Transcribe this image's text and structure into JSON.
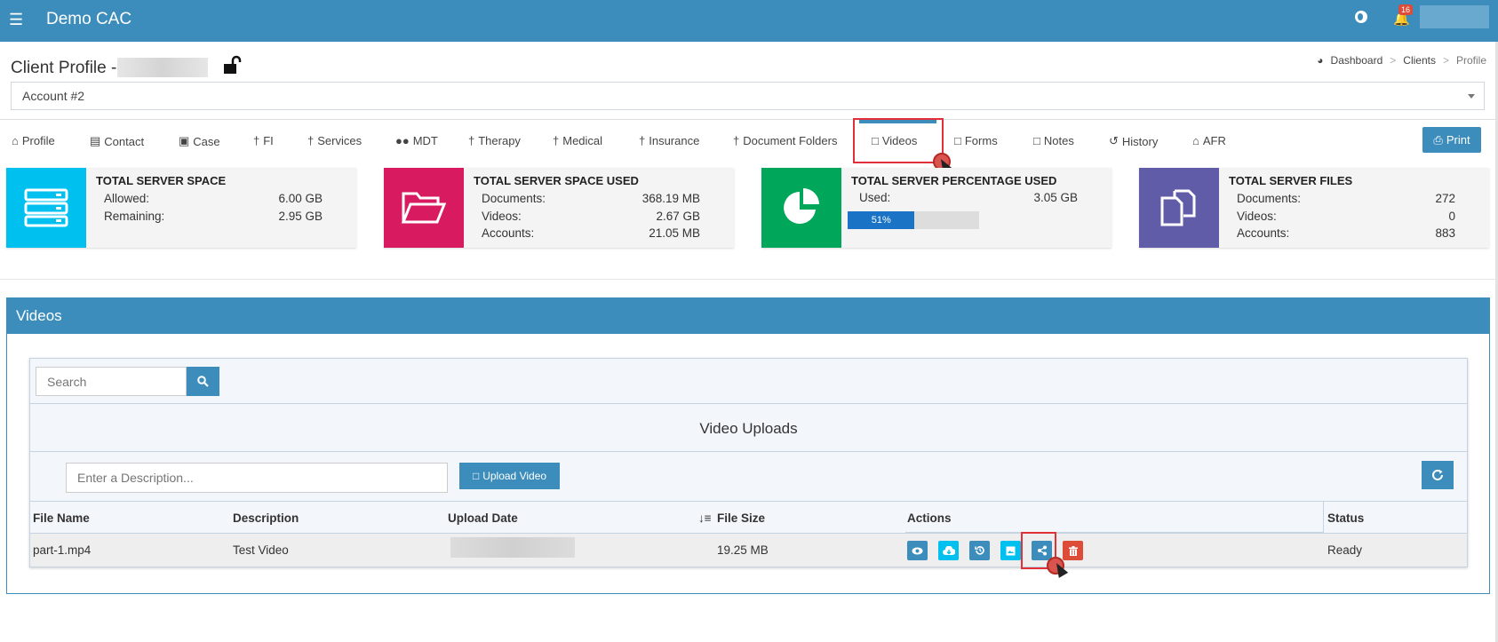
{
  "header": {
    "app_title": "Demo CAC",
    "notification_count": "16"
  },
  "page": {
    "title": "Client Profile -",
    "account_select": "Account #2"
  },
  "breadcrumb": [
    "Dashboard",
    "Clients",
    "Profile"
  ],
  "tabs": [
    {
      "label": "Profile"
    },
    {
      "label": "Contact"
    },
    {
      "label": "Case"
    },
    {
      "label": "FI"
    },
    {
      "label": "Services"
    },
    {
      "label": "MDT"
    },
    {
      "label": "Therapy"
    },
    {
      "label": "Medical"
    },
    {
      "label": "Insurance"
    },
    {
      "label": "Document Folders"
    },
    {
      "label": "Videos"
    },
    {
      "label": "Forms"
    },
    {
      "label": "Notes"
    },
    {
      "label": "History"
    },
    {
      "label": "AFR"
    }
  ],
  "active_tab": "Videos",
  "print_label": "Print",
  "stats": {
    "space": {
      "title": "TOTAL SERVER SPACE",
      "rows": [
        [
          "Allowed:",
          "6.00 GB"
        ],
        [
          "Remaining:",
          "2.95 GB"
        ]
      ],
      "color": "#00c0ef"
    },
    "used": {
      "title": "TOTAL SERVER SPACE USED",
      "rows": [
        [
          "Documents:",
          "368.19 MB"
        ],
        [
          "Videos:",
          "2.67 GB"
        ],
        [
          "Accounts:",
          "21.05 MB"
        ]
      ],
      "color": "#d81b60"
    },
    "percent": {
      "title": "TOTAL SERVER PERCENTAGE USED",
      "rows": [
        [
          "Used:",
          "3.05 GB"
        ]
      ],
      "progress_label": "51%",
      "progress": 0.51,
      "color": "#00a65a"
    },
    "files": {
      "title": "TOTAL SERVER FILES",
      "rows": [
        [
          "Documents:",
          "272"
        ],
        [
          "Videos:",
          "0"
        ],
        [
          "Accounts:",
          "883"
        ]
      ],
      "color": "#605ca8"
    }
  },
  "videos_panel": {
    "title": "Videos",
    "search_placeholder": "Search",
    "section_title": "Video Uploads",
    "description_placeholder": "Enter a Description...",
    "upload_label": "Upload Video",
    "columns": [
      "File Name",
      "Description",
      "Upload Date",
      "File Size",
      "Actions",
      "Status"
    ],
    "rows": [
      {
        "file_name": "part-1.mp4",
        "description": "Test Video",
        "file_size": "19.25 MB",
        "status": "Ready"
      }
    ],
    "action_icons": [
      "view-icon",
      "download-icon",
      "history-icon",
      "thumbnail-icon",
      "share-icon",
      "delete-icon"
    ]
  }
}
